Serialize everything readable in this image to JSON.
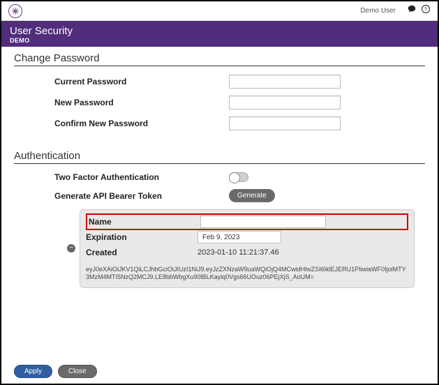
{
  "topbar": {
    "username": "Demo User"
  },
  "hero": {
    "title": "User Security",
    "subtitle": "DEMO"
  },
  "sections": {
    "change_password": {
      "title": "Change Password",
      "current_label": "Current Password",
      "new_label": "New Password",
      "confirm_label": "Confirm New Password"
    },
    "authentication": {
      "title": "Authentication",
      "two_factor_label": "Two Factor Authentication",
      "generate_label": "Generate API Bearer Token",
      "generate_button": "Generate"
    }
  },
  "token": {
    "name_label": "Name",
    "name_value": "",
    "expiration_label": "Expiration",
    "expiration_value": "Feb 9, 2023",
    "created_label": "Created",
    "created_value": "2023-01-10 11:21:37.46",
    "token_string": "eyJ0eXAiOiJKV1QiLCJhbGciOiJIUzI1NiJ9.eyJzZXNzaW9uaWQiOjQ4MCwidHlwZSI6IklEJERU1PIiwiaWF0IjoiMTY3MzM4MTI5NzQ2MCJ9.LE8bbWbgXu90lBLKayiq0Vgs66UOuz06PEjXjS_AoUM="
  },
  "footer": {
    "apply": "Apply",
    "close": "Close"
  }
}
